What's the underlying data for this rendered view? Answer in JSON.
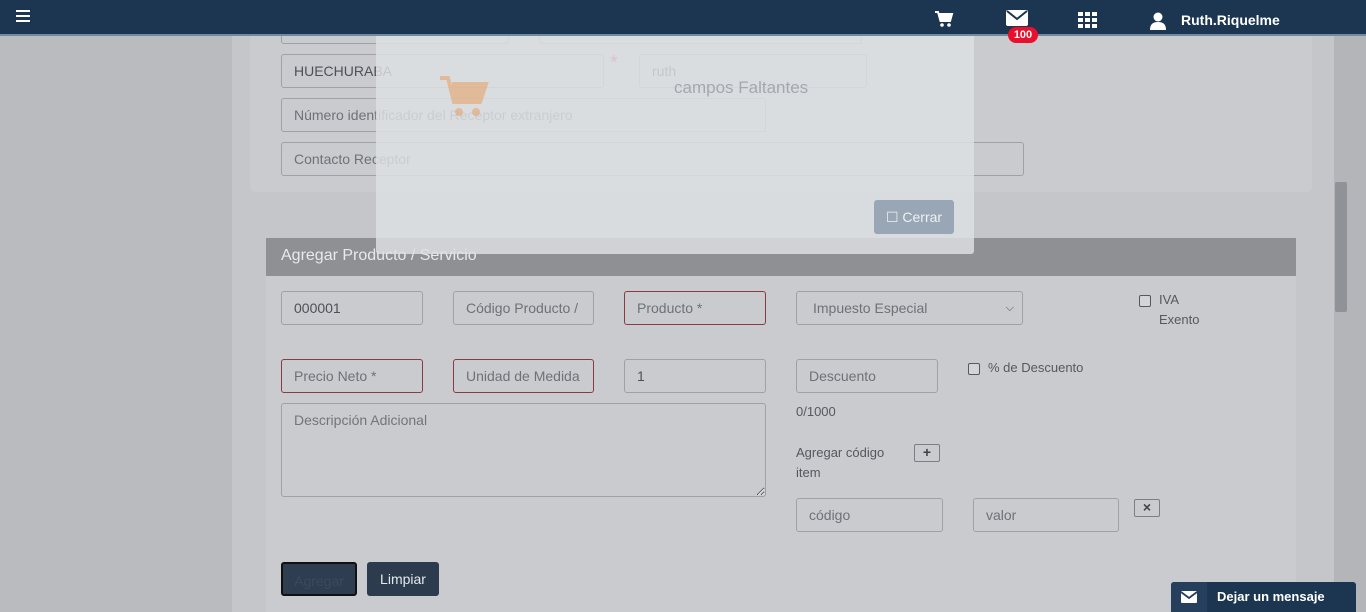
{
  "navbar": {
    "user_name": "Ruth.Riquelme",
    "mail_badge": "100"
  },
  "receptor": {
    "comuna_value": "HUECHURABA",
    "contact_name_value": "ruth",
    "id_extranjero_placeholder": "Número identificador del Receptor extranjero",
    "contacto_placeholder": "Contacto Receptor",
    "required_mark": "*"
  },
  "modal": {
    "title": "campos Faltantes",
    "close_label": "Cerrar",
    "close_icon": "☐"
  },
  "producto": {
    "header": "Agregar Producto / Servicio",
    "numero_value": "000001",
    "codigo_placeholder": "Código Producto /",
    "producto_placeholder": "Producto *",
    "impuesto_selected": "Impuesto Especial",
    "iva_label_1": "IVA",
    "iva_label_2": "Exento",
    "precio_placeholder": "Precio Neto *",
    "unidad_placeholder": "Unidad de Medida",
    "cantidad_value": "1",
    "descuento_placeholder": "Descuento",
    "pct_descuento_label": "% de Descuento",
    "descripcion_placeholder": "Descripción Adicional",
    "char_count": "0/1000",
    "agregar_codigo_label_1": "Agregar código",
    "agregar_codigo_label_2": "item",
    "codigo_item_placeholder": "código",
    "valor_placeholder": "valor",
    "agregar_button": "Agregar",
    "limpiar_button": "Limpiar"
  },
  "chat": {
    "label": "Dejar un mensaje"
  }
}
